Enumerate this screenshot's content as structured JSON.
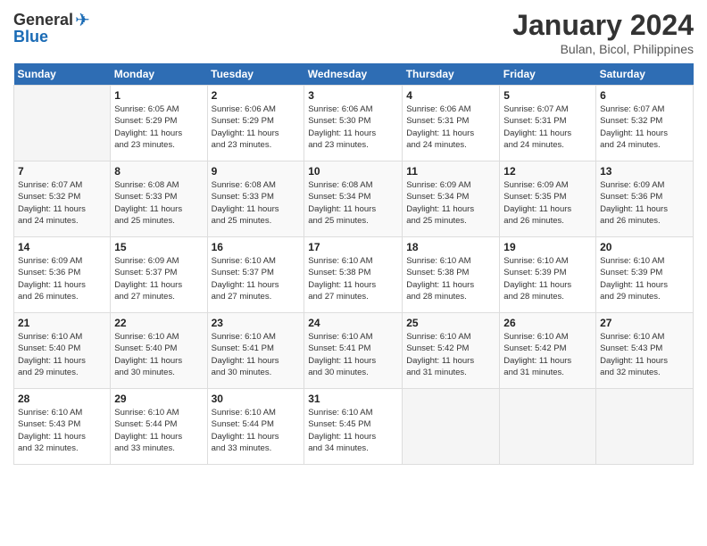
{
  "header": {
    "logo_general": "General",
    "logo_blue": "Blue",
    "month_year": "January 2024",
    "location": "Bulan, Bicol, Philippines"
  },
  "days_of_week": [
    "Sunday",
    "Monday",
    "Tuesday",
    "Wednesday",
    "Thursday",
    "Friday",
    "Saturday"
  ],
  "weeks": [
    [
      {
        "day": "",
        "info": ""
      },
      {
        "day": "1",
        "info": "Sunrise: 6:05 AM\nSunset: 5:29 PM\nDaylight: 11 hours\nand 23 minutes."
      },
      {
        "day": "2",
        "info": "Sunrise: 6:06 AM\nSunset: 5:29 PM\nDaylight: 11 hours\nand 23 minutes."
      },
      {
        "day": "3",
        "info": "Sunrise: 6:06 AM\nSunset: 5:30 PM\nDaylight: 11 hours\nand 23 minutes."
      },
      {
        "day": "4",
        "info": "Sunrise: 6:06 AM\nSunset: 5:31 PM\nDaylight: 11 hours\nand 24 minutes."
      },
      {
        "day": "5",
        "info": "Sunrise: 6:07 AM\nSunset: 5:31 PM\nDaylight: 11 hours\nand 24 minutes."
      },
      {
        "day": "6",
        "info": "Sunrise: 6:07 AM\nSunset: 5:32 PM\nDaylight: 11 hours\nand 24 minutes."
      }
    ],
    [
      {
        "day": "7",
        "info": "Sunrise: 6:07 AM\nSunset: 5:32 PM\nDaylight: 11 hours\nand 24 minutes."
      },
      {
        "day": "8",
        "info": "Sunrise: 6:08 AM\nSunset: 5:33 PM\nDaylight: 11 hours\nand 25 minutes."
      },
      {
        "day": "9",
        "info": "Sunrise: 6:08 AM\nSunset: 5:33 PM\nDaylight: 11 hours\nand 25 minutes."
      },
      {
        "day": "10",
        "info": "Sunrise: 6:08 AM\nSunset: 5:34 PM\nDaylight: 11 hours\nand 25 minutes."
      },
      {
        "day": "11",
        "info": "Sunrise: 6:09 AM\nSunset: 5:34 PM\nDaylight: 11 hours\nand 25 minutes."
      },
      {
        "day": "12",
        "info": "Sunrise: 6:09 AM\nSunset: 5:35 PM\nDaylight: 11 hours\nand 26 minutes."
      },
      {
        "day": "13",
        "info": "Sunrise: 6:09 AM\nSunset: 5:36 PM\nDaylight: 11 hours\nand 26 minutes."
      }
    ],
    [
      {
        "day": "14",
        "info": "Sunrise: 6:09 AM\nSunset: 5:36 PM\nDaylight: 11 hours\nand 26 minutes."
      },
      {
        "day": "15",
        "info": "Sunrise: 6:09 AM\nSunset: 5:37 PM\nDaylight: 11 hours\nand 27 minutes."
      },
      {
        "day": "16",
        "info": "Sunrise: 6:10 AM\nSunset: 5:37 PM\nDaylight: 11 hours\nand 27 minutes."
      },
      {
        "day": "17",
        "info": "Sunrise: 6:10 AM\nSunset: 5:38 PM\nDaylight: 11 hours\nand 27 minutes."
      },
      {
        "day": "18",
        "info": "Sunrise: 6:10 AM\nSunset: 5:38 PM\nDaylight: 11 hours\nand 28 minutes."
      },
      {
        "day": "19",
        "info": "Sunrise: 6:10 AM\nSunset: 5:39 PM\nDaylight: 11 hours\nand 28 minutes."
      },
      {
        "day": "20",
        "info": "Sunrise: 6:10 AM\nSunset: 5:39 PM\nDaylight: 11 hours\nand 29 minutes."
      }
    ],
    [
      {
        "day": "21",
        "info": "Sunrise: 6:10 AM\nSunset: 5:40 PM\nDaylight: 11 hours\nand 29 minutes."
      },
      {
        "day": "22",
        "info": "Sunrise: 6:10 AM\nSunset: 5:40 PM\nDaylight: 11 hours\nand 30 minutes."
      },
      {
        "day": "23",
        "info": "Sunrise: 6:10 AM\nSunset: 5:41 PM\nDaylight: 11 hours\nand 30 minutes."
      },
      {
        "day": "24",
        "info": "Sunrise: 6:10 AM\nSunset: 5:41 PM\nDaylight: 11 hours\nand 30 minutes."
      },
      {
        "day": "25",
        "info": "Sunrise: 6:10 AM\nSunset: 5:42 PM\nDaylight: 11 hours\nand 31 minutes."
      },
      {
        "day": "26",
        "info": "Sunrise: 6:10 AM\nSunset: 5:42 PM\nDaylight: 11 hours\nand 31 minutes."
      },
      {
        "day": "27",
        "info": "Sunrise: 6:10 AM\nSunset: 5:43 PM\nDaylight: 11 hours\nand 32 minutes."
      }
    ],
    [
      {
        "day": "28",
        "info": "Sunrise: 6:10 AM\nSunset: 5:43 PM\nDaylight: 11 hours\nand 32 minutes."
      },
      {
        "day": "29",
        "info": "Sunrise: 6:10 AM\nSunset: 5:44 PM\nDaylight: 11 hours\nand 33 minutes."
      },
      {
        "day": "30",
        "info": "Sunrise: 6:10 AM\nSunset: 5:44 PM\nDaylight: 11 hours\nand 33 minutes."
      },
      {
        "day": "31",
        "info": "Sunrise: 6:10 AM\nSunset: 5:45 PM\nDaylight: 11 hours\nand 34 minutes."
      },
      {
        "day": "",
        "info": ""
      },
      {
        "day": "",
        "info": ""
      },
      {
        "day": "",
        "info": ""
      }
    ]
  ]
}
